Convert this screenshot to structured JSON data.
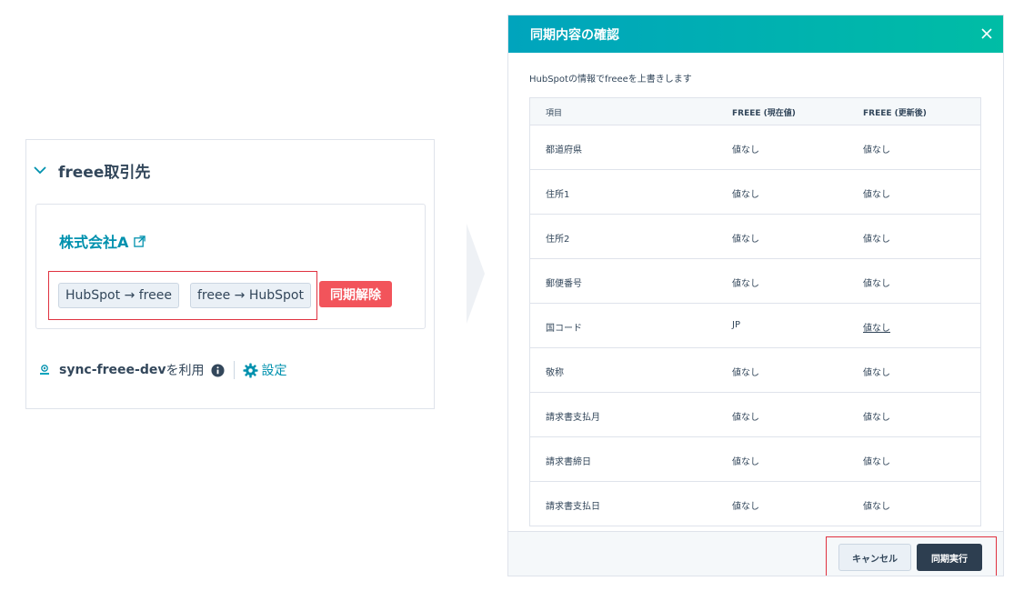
{
  "card": {
    "title": "freee取引先",
    "company_name": "株式会社A",
    "sync_buttons": [
      "HubSpot → freee",
      "freee → HubSpot"
    ],
    "unsync_label": "同期解除",
    "app_name": "sync-freee-dev",
    "use_label": "を利用",
    "settings_label": "設定"
  },
  "modal": {
    "title": "同期内容の確認",
    "description": "HubSpotの情報でfreeeを上書きします",
    "columns": [
      "項目",
      "FREEE (現在値)",
      "FREEE (更新後)"
    ],
    "rows": [
      {
        "item": "都道府県",
        "current": "値なし",
        "updated": "値なし"
      },
      {
        "item": "住所1",
        "current": "値なし",
        "updated": "値なし"
      },
      {
        "item": "住所2",
        "current": "値なし",
        "updated": "値なし"
      },
      {
        "item": "郵便番号",
        "current": "値なし",
        "updated": "値なし"
      },
      {
        "item": "国コード",
        "current": "JP",
        "updated": "値なし"
      },
      {
        "item": "敬称",
        "current": "値なし",
        "updated": "値なし"
      },
      {
        "item": "請求書支払月",
        "current": "値なし",
        "updated": "値なし"
      },
      {
        "item": "請求書締日",
        "current": "値なし",
        "updated": "値なし"
      },
      {
        "item": "請求書支払日",
        "current": "値なし",
        "updated": "値なし"
      }
    ],
    "cancel_label": "キャンセル",
    "execute_label": "同期実行"
  },
  "colors": {
    "accent_teal": "#00a4bd",
    "link": "#0091ae",
    "danger": "#f2545b",
    "highlight_border": "#e0313f",
    "dark_button": "#2d3e50"
  },
  "icons": [
    "chevron-down-icon",
    "external-link-icon",
    "sync-logo-icon",
    "info-icon",
    "gear-icon",
    "close-icon",
    "arrow-right-icon"
  ]
}
